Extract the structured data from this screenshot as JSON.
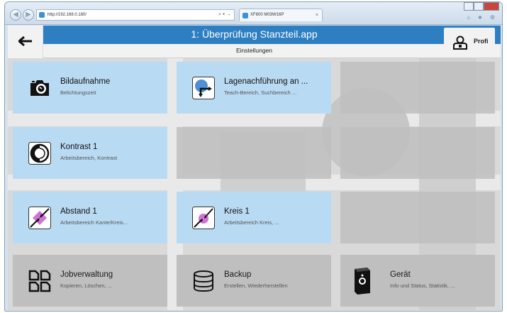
{
  "browser": {
    "url": "http://192.168.0.180/",
    "address_controls": "⌕ ▾ →",
    "tab_title": "XF800 M03W16P",
    "tab_close": "×",
    "back_glyph": "◀",
    "forward_glyph": "▶",
    "right_tools": "⌂ ★ ⚙"
  },
  "header": {
    "title": "1: Überprüfung Stanzteil.app",
    "subtitle": "Einstellungen",
    "profile_label": "Profi"
  },
  "tiles": [
    {
      "title": "Bildaufnahme",
      "subtitle": "Belichtungszeit",
      "icon": "camera-icon",
      "style": "blue"
    },
    {
      "title": "Lagenachführung an ...",
      "subtitle": "Teach-Bereich, Suchbereich ...",
      "icon": "position-tracking-icon",
      "style": "blue"
    },
    {
      "title": "Kontrast 1",
      "subtitle": "Arbeitsbereich, Kontrast",
      "icon": "contrast-icon",
      "style": "blue"
    },
    {
      "title": "Abstand 1",
      "subtitle": "Arbeitsbereich Kante/Kreis...",
      "icon": "distance-icon",
      "style": "blue"
    },
    {
      "title": "Kreis 1",
      "subtitle": "Arbeitsbereich Kreis, ...",
      "icon": "circle-tool-icon",
      "style": "blue"
    },
    {
      "title": "Jobverwaltung",
      "subtitle": "Kopieren, Löschen, ...",
      "icon": "job-management-icon",
      "style": "gray"
    },
    {
      "title": "Backup",
      "subtitle": "Erstellen, Wiederherstellen",
      "icon": "database-icon",
      "style": "gray"
    },
    {
      "title": "Gerät",
      "subtitle": "Info und Status, Statistik, ...",
      "icon": "sensor-device-icon",
      "style": "gray"
    }
  ],
  "colors": {
    "title_bar": "#2d7fc1",
    "tile_blue": "#b9daf3",
    "tile_gray": "#bfbfbf",
    "accent_magenta": "#d173d6"
  }
}
